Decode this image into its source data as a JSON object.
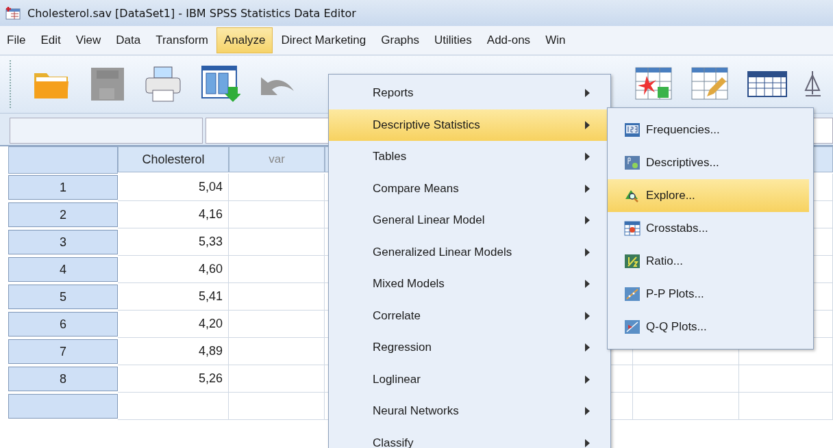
{
  "window": {
    "title": "Cholesterol.sav [DataSet1] - IBM SPSS Statistics Data Editor"
  },
  "menu_bar": [
    {
      "label": "File",
      "selected": false
    },
    {
      "label": "Edit",
      "selected": false
    },
    {
      "label": "View",
      "selected": false
    },
    {
      "label": "Data",
      "selected": false
    },
    {
      "label": "Transform",
      "selected": false
    },
    {
      "label": "Analyze",
      "selected": true
    },
    {
      "label": "Direct Marketing",
      "selected": false
    },
    {
      "label": "Graphs",
      "selected": false
    },
    {
      "label": "Utilities",
      "selected": false
    },
    {
      "label": "Add-ons",
      "selected": false
    },
    {
      "label": "Win",
      "selected": false
    }
  ],
  "toolbar": [
    {
      "kind": "open",
      "disabled": false
    },
    {
      "kind": "save",
      "disabled": true
    },
    {
      "kind": "print",
      "disabled": false
    },
    {
      "kind": "import",
      "disabled": false
    },
    {
      "kind": "undo",
      "disabled": true
    }
  ],
  "toolbar_right": [
    {
      "kind": "star-table"
    },
    {
      "kind": "edit-table"
    },
    {
      "kind": "grid"
    },
    {
      "kind": "scale"
    }
  ],
  "grid": {
    "columns": [
      {
        "label": "Cholesterol",
        "kind": "variable"
      },
      {
        "label": "var",
        "kind": "empty"
      }
    ],
    "rows": [
      {
        "number": "1",
        "value": "5,04"
      },
      {
        "number": "2",
        "value": "4,16"
      },
      {
        "number": "3",
        "value": "5,33"
      },
      {
        "number": "4",
        "value": "4,60"
      },
      {
        "number": "5",
        "value": "5,41"
      },
      {
        "number": "6",
        "value": "4,20"
      },
      {
        "number": "7",
        "value": "4,89"
      },
      {
        "number": "8",
        "value": "5,26"
      }
    ]
  },
  "analyze_menu": [
    {
      "label": "Reports",
      "selected": false,
      "submenu": true
    },
    {
      "label": "Descriptive Statistics",
      "selected": true,
      "submenu": true
    },
    {
      "label": "Tables",
      "selected": false,
      "submenu": true
    },
    {
      "label": "Compare Means",
      "selected": false,
      "submenu": true
    },
    {
      "label": "General Linear Model",
      "selected": false,
      "submenu": true
    },
    {
      "label": "Generalized Linear Models",
      "selected": false,
      "submenu": true
    },
    {
      "label": "Mixed Models",
      "selected": false,
      "submenu": true
    },
    {
      "label": "Correlate",
      "selected": false,
      "submenu": true
    },
    {
      "label": "Regression",
      "selected": false,
      "submenu": true
    },
    {
      "label": "Loglinear",
      "selected": false,
      "submenu": true
    },
    {
      "label": "Neural Networks",
      "selected": false,
      "submenu": true
    },
    {
      "label": "Classify",
      "selected": false,
      "submenu": true
    }
  ],
  "descriptive_submenu": [
    {
      "label": "Frequencies...",
      "selected": false,
      "kind": "frequencies"
    },
    {
      "label": "Descriptives...",
      "selected": false,
      "kind": "descriptives"
    },
    {
      "label": "Explore...",
      "selected": true,
      "kind": "explore"
    },
    {
      "label": "Crosstabs...",
      "selected": false,
      "kind": "crosstabs"
    },
    {
      "label": "Ratio...",
      "selected": false,
      "kind": "ratio"
    },
    {
      "label": "P-P Plots...",
      "selected": false,
      "kind": "pp"
    },
    {
      "label": "Q-Q Plots...",
      "selected": false,
      "kind": "qq"
    }
  ]
}
